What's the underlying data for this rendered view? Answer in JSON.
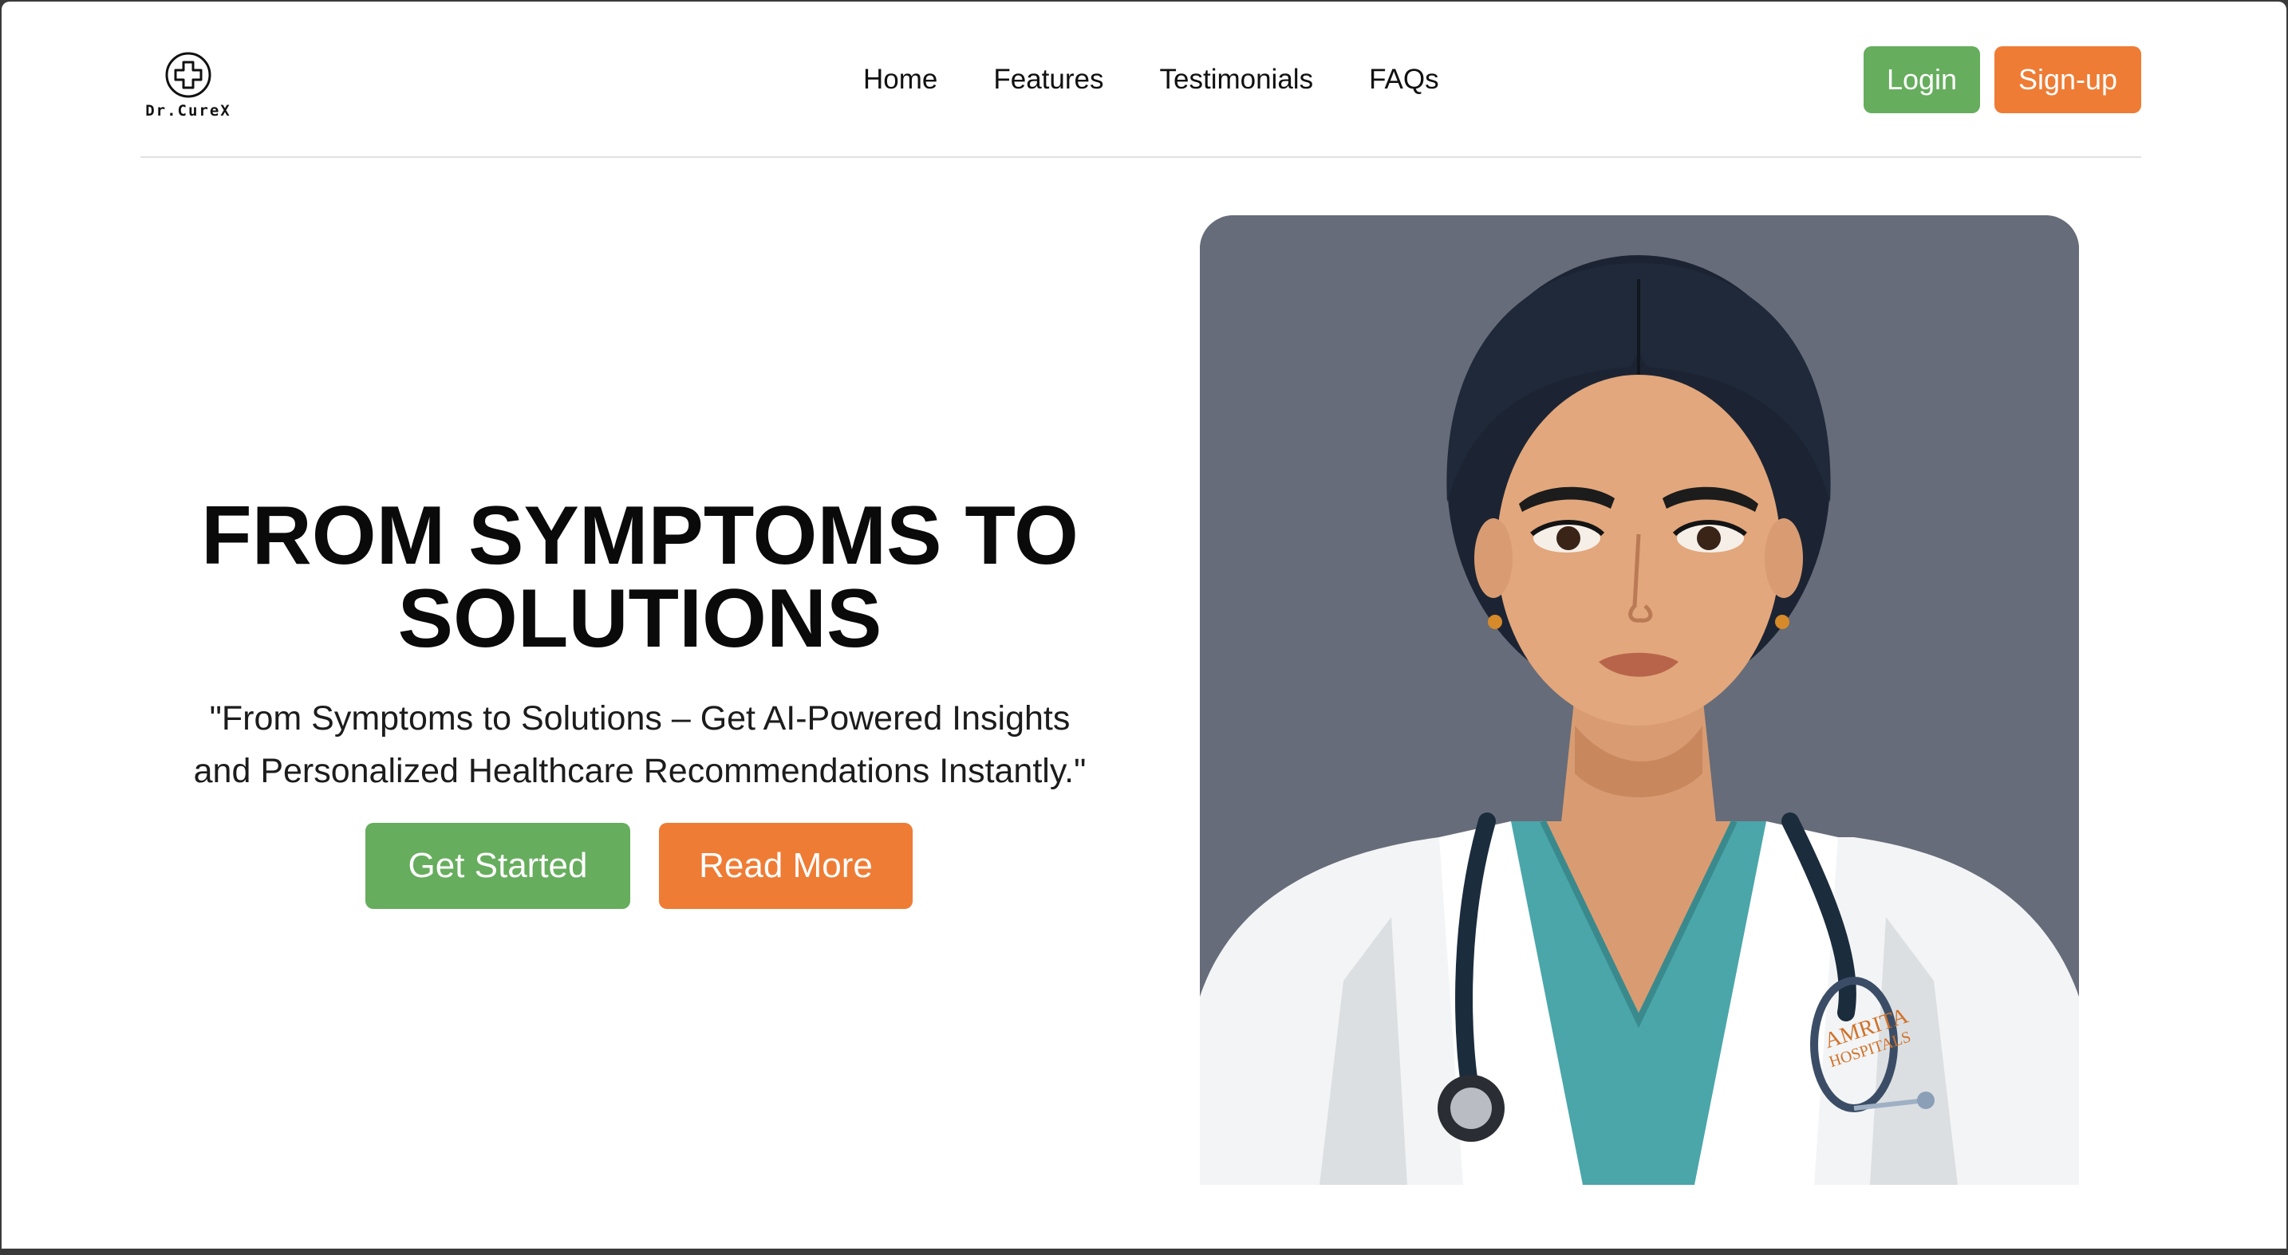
{
  "brand": {
    "name": "Dr.CureX",
    "logo_icon": "medical-cross-icon"
  },
  "nav": {
    "items": [
      {
        "label": "Home"
      },
      {
        "label": "Features"
      },
      {
        "label": "Testimonials"
      },
      {
        "label": "FAQs"
      }
    ]
  },
  "auth": {
    "login_label": "Login",
    "signup_label": "Sign-up"
  },
  "hero": {
    "title_line1": "FROM SYMPTOMS TO",
    "title_line2": "SOLUTIONS",
    "subtitle_line1": "\"From Symptoms to Solutions – Get AI-Powered Insights",
    "subtitle_line2": "and Personalized Healthcare Recommendations Instantly.\"",
    "get_started_label": "Get Started",
    "read_more_label": "Read More",
    "image_subject": "doctor-illustration",
    "badge_line1": "AMRITA",
    "badge_line2": "HOSPITALS"
  },
  "colors": {
    "accent_green": "#66ad5e",
    "accent_orange": "#ee7c35",
    "image_background": "#666c79",
    "scrub_teal": "#4aa6a9"
  }
}
